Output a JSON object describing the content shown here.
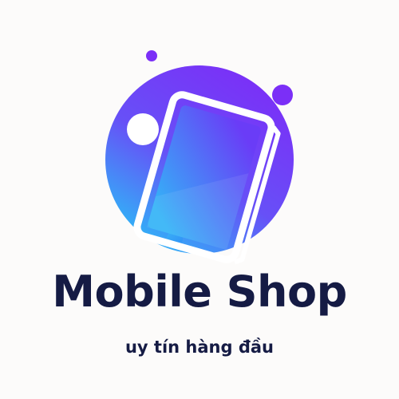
{
  "brand": {
    "name": "Mobile Shop",
    "tagline": "uy tín hàng đầu"
  },
  "logo": {
    "icon": "smartphone-icon",
    "colors": {
      "gradient_start": "#7b2ff7",
      "gradient_end": "#2fb6f7",
      "bubble_purple": "#7b2ff7",
      "bubble_white": "#ffffff",
      "bubble_blue": "#2fb6f7",
      "text": "#151b44",
      "background": "#fcfbfa"
    }
  }
}
